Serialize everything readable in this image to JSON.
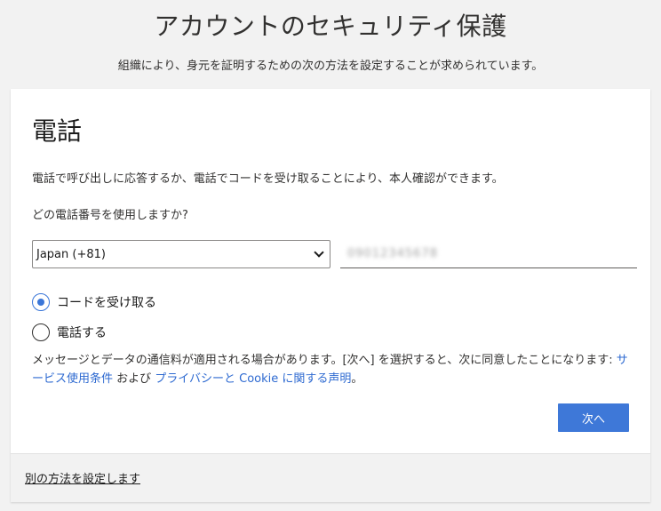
{
  "header": {
    "title": "アカウントのセキュリティ保護",
    "subtitle": "組織により、身元を証明するための次の方法を設定することが求められています。"
  },
  "card": {
    "title": "電話",
    "description": "電話で呼び出しに応答するか、電話でコードを受け取ることにより、本人確認ができます。",
    "question": "どの電話番号を使用しますか?",
    "country_select": {
      "value": "Japan (+81)"
    },
    "phone_input": {
      "value": "09012345678"
    },
    "options": [
      {
        "label": "コードを受け取る",
        "checked": true
      },
      {
        "label": "電話する",
        "checked": false
      }
    ],
    "notice": {
      "text_before": "メッセージとデータの通信料が適用される場合があります。[次へ] を選択すると、次に同意したことになります: ",
      "terms_link": "サービス使用条件",
      "conjunction": " および ",
      "privacy_link": "プライバシーと Cookie に関する声明",
      "end": "。"
    },
    "next_button": "次へ",
    "footer_link": "別の方法を設定します"
  },
  "colors": {
    "accent": "#3e78d8",
    "link": "#2e6ad1",
    "background": "#f2f2f2"
  }
}
